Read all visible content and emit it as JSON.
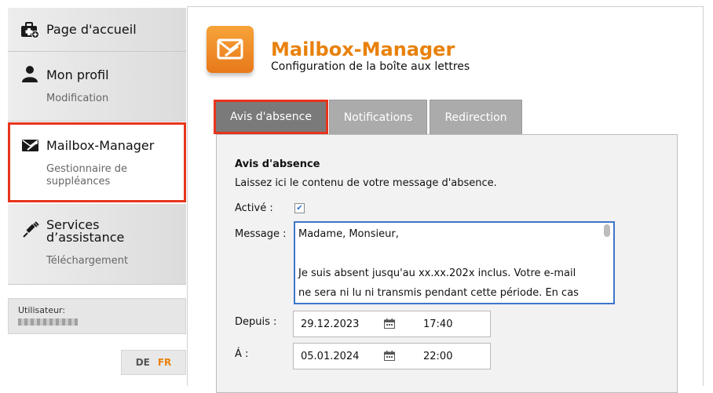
{
  "sidebar": {
    "items": [
      {
        "title": "Page d'accueil",
        "sub": "",
        "icon": "medical-case-icon"
      },
      {
        "title": "Mon profil",
        "sub": "Modification",
        "icon": "user-icon"
      },
      {
        "title": "Mailbox-Manager",
        "sub1": "Gestionnaire de",
        "sub2": "suppléances",
        "icon": "mailbox-icon"
      },
      {
        "title1": "Services",
        "title2": "d’assistance",
        "sub": "Téléchargement",
        "icon": "syringe-icon"
      }
    ],
    "user_label": "Utilisateur:",
    "languages": {
      "de": "DE",
      "fr": "FR"
    }
  },
  "header": {
    "title": "Mailbox-Manager",
    "subtitle": "Configuration de la boîte aux lettres",
    "icon": "mailbox-app-icon"
  },
  "tabs": [
    {
      "label": "Avis d'absence"
    },
    {
      "label": "Notifications"
    },
    {
      "label": "Redirection"
    }
  ],
  "form": {
    "section_title": "Avis d'absence",
    "description": "Laissez ici le contenu de votre message d'absence.",
    "active_label": "Activé :",
    "active_checked": true,
    "message_label": "Message :",
    "message_lines": [
      "Madame, Monsieur,",
      "",
      "Je suis absent jusqu'au xx.xx.202x inclus. Votre e-mail",
      "ne sera ni lu ni transmis pendant cette période. En cas"
    ],
    "from_label": "Depuis :",
    "from_date": "29.12.2023",
    "from_time": "17:40",
    "to_label": "Á :",
    "to_date": "05.01.2024",
    "to_time": "22:00"
  },
  "colors": {
    "accent": "#e8810c",
    "highlight": "#e8341c",
    "tab": "#ababab",
    "tab_active": "#7a7a7a"
  }
}
